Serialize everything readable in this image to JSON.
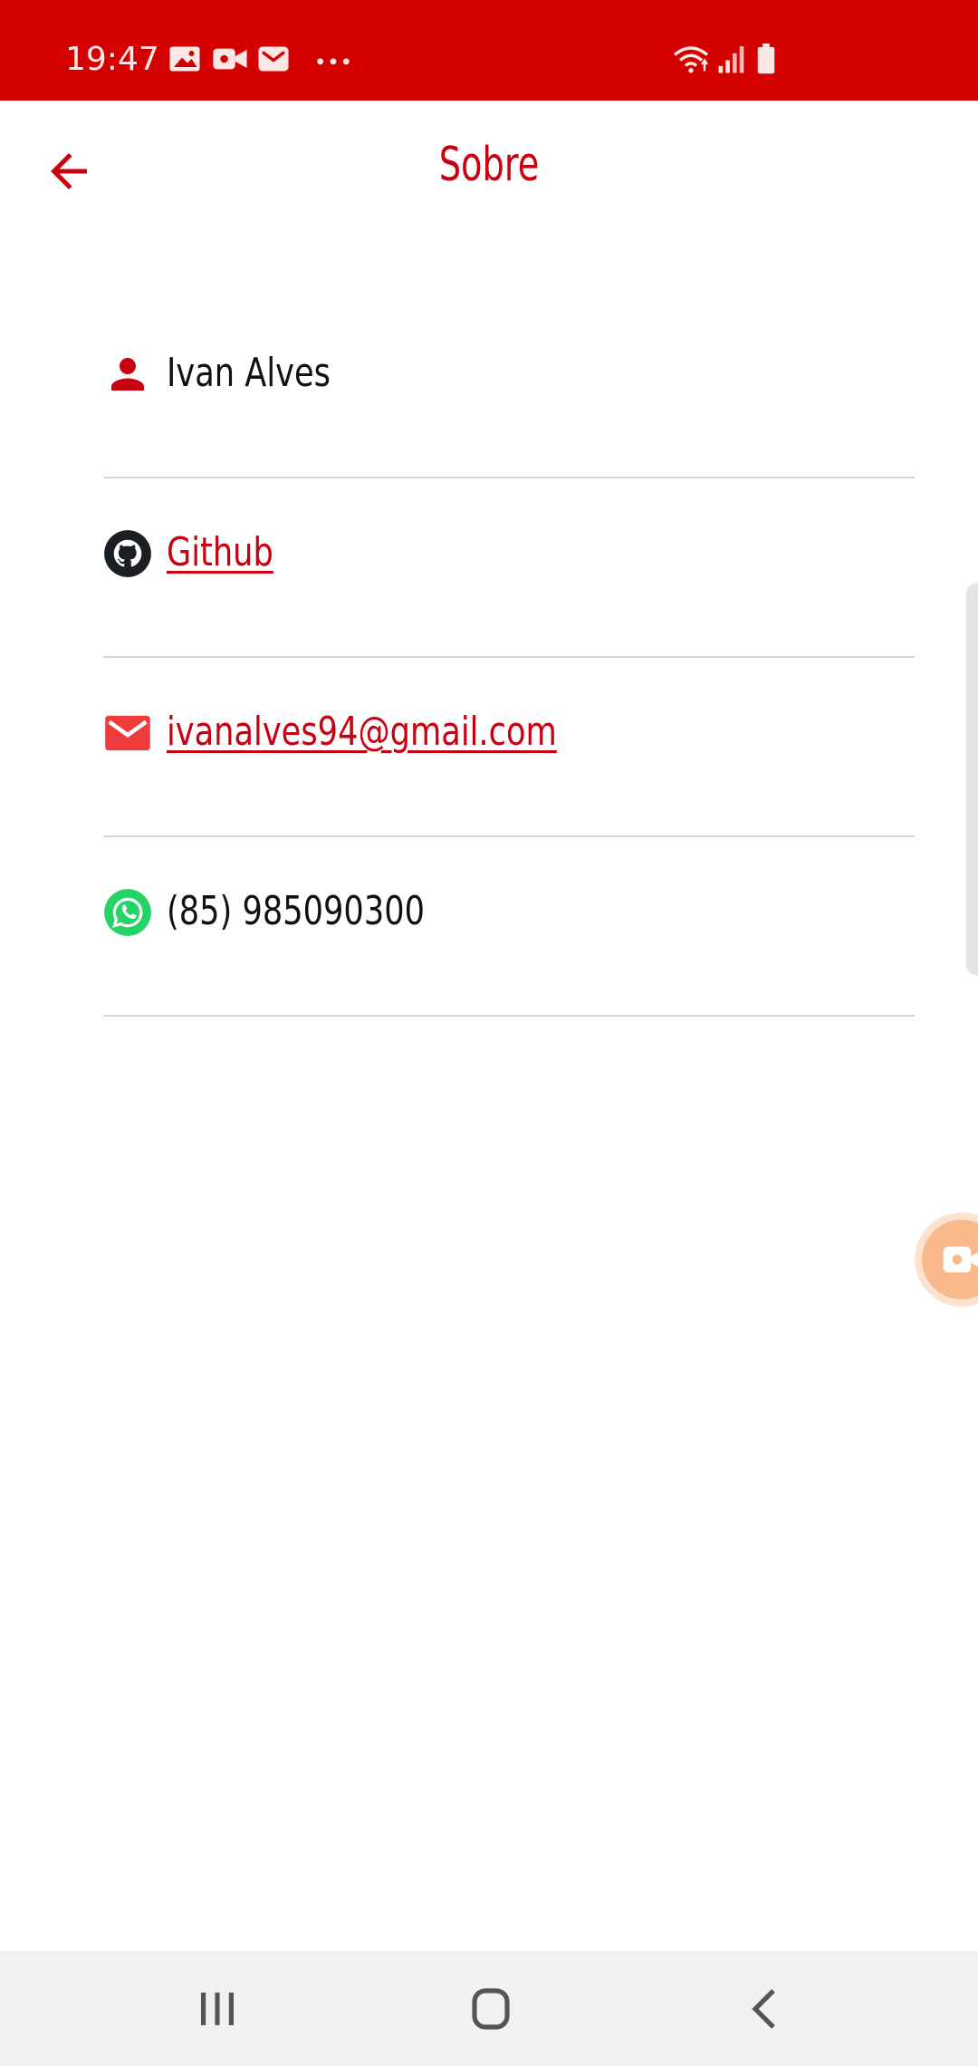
{
  "status_bar": {
    "time": "19:47",
    "notification_icons": [
      "image-icon",
      "video-call-icon",
      "mail-icon",
      "more-dots-icon"
    ],
    "system_icons": [
      "wifi-icon",
      "signal-icon",
      "battery-icon"
    ]
  },
  "app_bar": {
    "title": "Sobre",
    "back_icon": "arrow-left-icon"
  },
  "contacts": [
    {
      "icon": "person-icon",
      "text": "Ivan Alves",
      "is_link": false
    },
    {
      "icon": "github-icon",
      "text": "Github",
      "is_link": true
    },
    {
      "icon": "email-icon",
      "text": "ivanalves94@gmail.com",
      "is_link": true
    },
    {
      "icon": "whatsapp-icon",
      "text": "(85) 985090300",
      "is_link": false
    }
  ],
  "nav_bar": {
    "buttons": [
      "recent-apps-icon",
      "home-icon",
      "back-icon"
    ]
  },
  "colors": {
    "status_bar": "#d40000",
    "accent": "#c8000f",
    "email_icon": "#ef3b3b",
    "whatsapp": "#25d366",
    "divider": "#d6d6d6",
    "nav_bar": "#f1f1f1"
  }
}
